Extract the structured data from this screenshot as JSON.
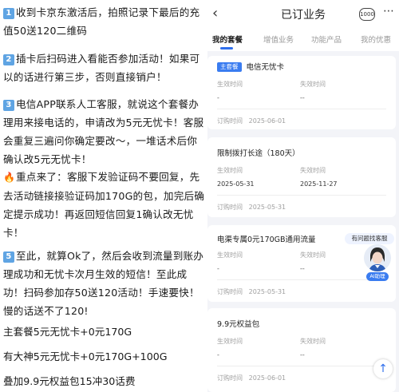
{
  "instructions": {
    "step1": {
      "badge": "1",
      "text": "收到卡京东激活后，拍照记录下最后的充值50送120二维码"
    },
    "step2": {
      "badge": "2",
      "text": "插卡后扫码进入看能否参加活动！如果可以的话进行第三步，否则直接销户！"
    },
    "step3": {
      "badge": "3",
      "text": "电信APP联系人工客服，就说这个套餐办理用来接电话的，申请改为5元无忧卡！客服会重复三遍问你确定要改～，一堆话术后你确认改5元无忧卡！"
    },
    "key_point": {
      "icon": "fire-icon",
      "text": "重点来了：客服下发验证码不要回复，先去活动链接接验证码加170G的包，加完后确定提示成功！再返回短信回复1确认改无忧卡！"
    },
    "step5": {
      "badge": "5",
      "text": "至此，就算Ok了，然后会收到流量到账办理成功和无忧卡次月生效的短信！至此成功！扫码参加存50送120活动！手速要快！慢的话送不了120!"
    },
    "plan_main": "主套餐5元无忧卡+0元170G",
    "plan_big": "有大神5元无忧卡+0元170G+100G",
    "plan_bundle": "叠加9.9元权益包15冲30话费"
  },
  "phone": {
    "header": {
      "title": "已订业务",
      "back_icon": "chevron-left-icon",
      "badge": "1000",
      "more_icon": "more-icon"
    },
    "tabs": [
      {
        "label": "我的套餐",
        "active": true
      },
      {
        "label": "增值业务",
        "active": false
      },
      {
        "label": "功能产品",
        "active": false
      },
      {
        "label": "我的优惠",
        "active": false
      }
    ],
    "cards": [
      {
        "tag": "主套餐",
        "name": "电信无忧卡",
        "effective_label": "生效时间",
        "effective_value": "-",
        "expire_label": "失效时间",
        "expire_value": "--",
        "order_label": "订购时间",
        "order_value": "2025-06-01"
      },
      {
        "tag": "",
        "name": "限制拨打长途（180天）",
        "effective_label": "生效时间",
        "effective_value": "2025-05-31",
        "expire_label": "失效时间",
        "expire_value": "2025-11-27",
        "order_label": "订购时间",
        "order_value": "2025-05-31"
      },
      {
        "tag": "",
        "name": "电渠专属0元170GB通用流量",
        "effective_label": "生效时间",
        "effective_value": "-",
        "expire_label": "失效时间",
        "expire_value": "--",
        "order_label": "订购时间",
        "order_value": "2025-05-31"
      },
      {
        "tag": "",
        "name": "9.9元权益包",
        "effective_label": "生效时间",
        "effective_value": "-",
        "expire_label": "失效时间",
        "expire_value": "--",
        "order_label": "订购时间",
        "order_value": "2025-06-01"
      }
    ],
    "customer_service": {
      "tip": "有问题找客服",
      "name": "AI助理"
    },
    "scroll_top_icon": "arrow-up-icon"
  },
  "colors": {
    "badge_blue": "#5fa4e3",
    "accent_blue": "#3a7cf0",
    "phone_bg": "#f3f4f8"
  }
}
